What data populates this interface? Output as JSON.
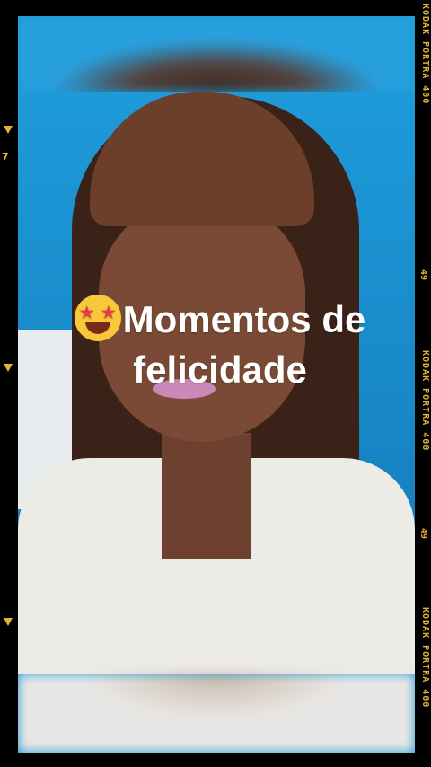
{
  "caption": {
    "line1": "Momentos de",
    "line2": "felicidade",
    "emoji": "star-struck-emoji"
  },
  "film_border": {
    "brand_top": "KODAK PORTRA 400",
    "brand_mid": "KODAK PORTRA 400",
    "brand_bottom": "KODAK PORTRA 400",
    "frame_number_right_1": "49",
    "frame_number_right_2": "49",
    "frame_number_left": "7",
    "accent_color": "#e4b13a"
  }
}
